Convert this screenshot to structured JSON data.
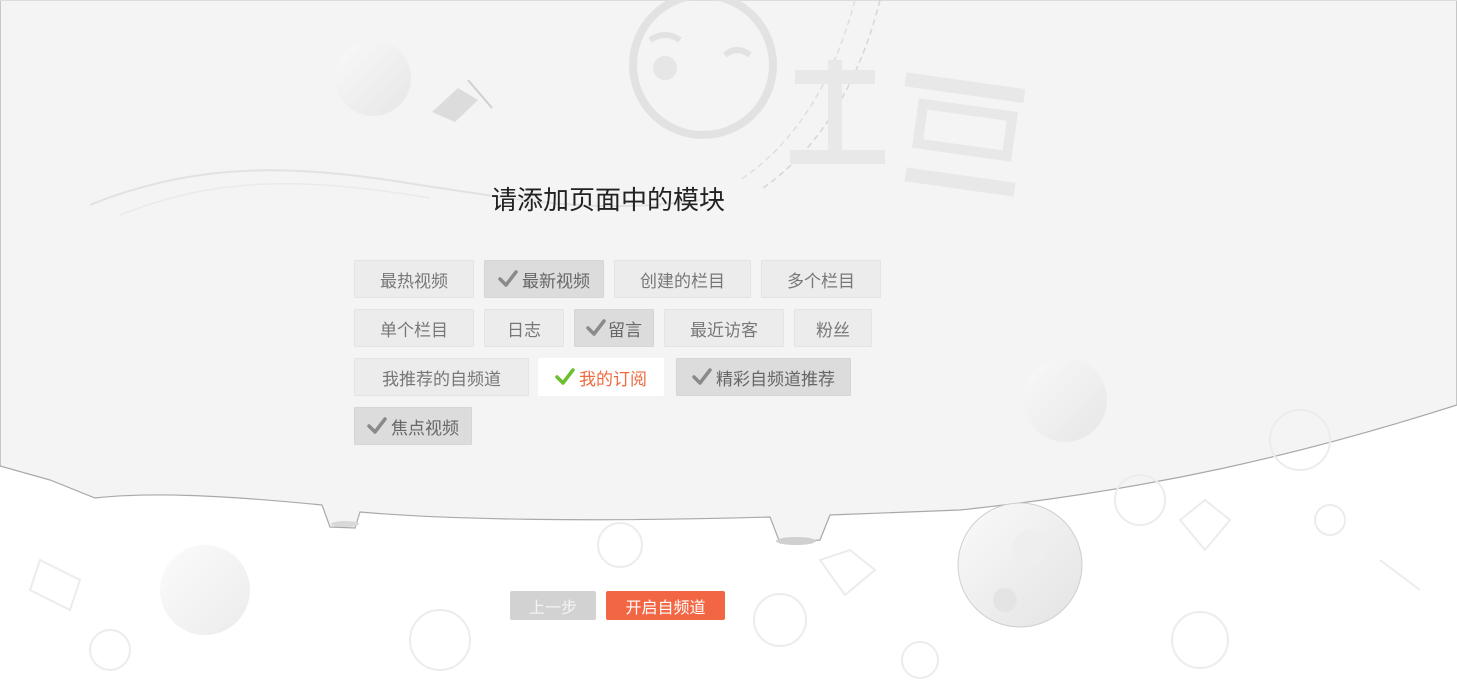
{
  "page": {
    "title": "请添加页面中的模块",
    "brand_watermark": "土豆"
  },
  "modules": [
    {
      "label": "最热视频",
      "state": "default"
    },
    {
      "label": "最新视频",
      "state": "selected"
    },
    {
      "label": "创建的栏目",
      "state": "default"
    },
    {
      "label": "多个栏目",
      "state": "default"
    },
    {
      "label": "单个栏目",
      "state": "default"
    },
    {
      "label": "日志",
      "state": "default"
    },
    {
      "label": "留言",
      "state": "selected"
    },
    {
      "label": "最近访客",
      "state": "default"
    },
    {
      "label": "粉丝",
      "state": "default"
    },
    {
      "label": "我推荐的自频道",
      "state": "default"
    },
    {
      "label": "我的订阅",
      "state": "active"
    },
    {
      "label": "精彩自频道推荐",
      "state": "selected"
    },
    {
      "label": "焦点视频",
      "state": "selected"
    }
  ],
  "buttons": {
    "prev_label": "上一步",
    "next_label": "开启自频道"
  },
  "colors": {
    "accent": "#f26644",
    "active_text": "#ef6a3e",
    "check_green": "#6cbf2e",
    "check_gray": "#8a8a8a"
  },
  "icons": [
    "check-icon"
  ]
}
